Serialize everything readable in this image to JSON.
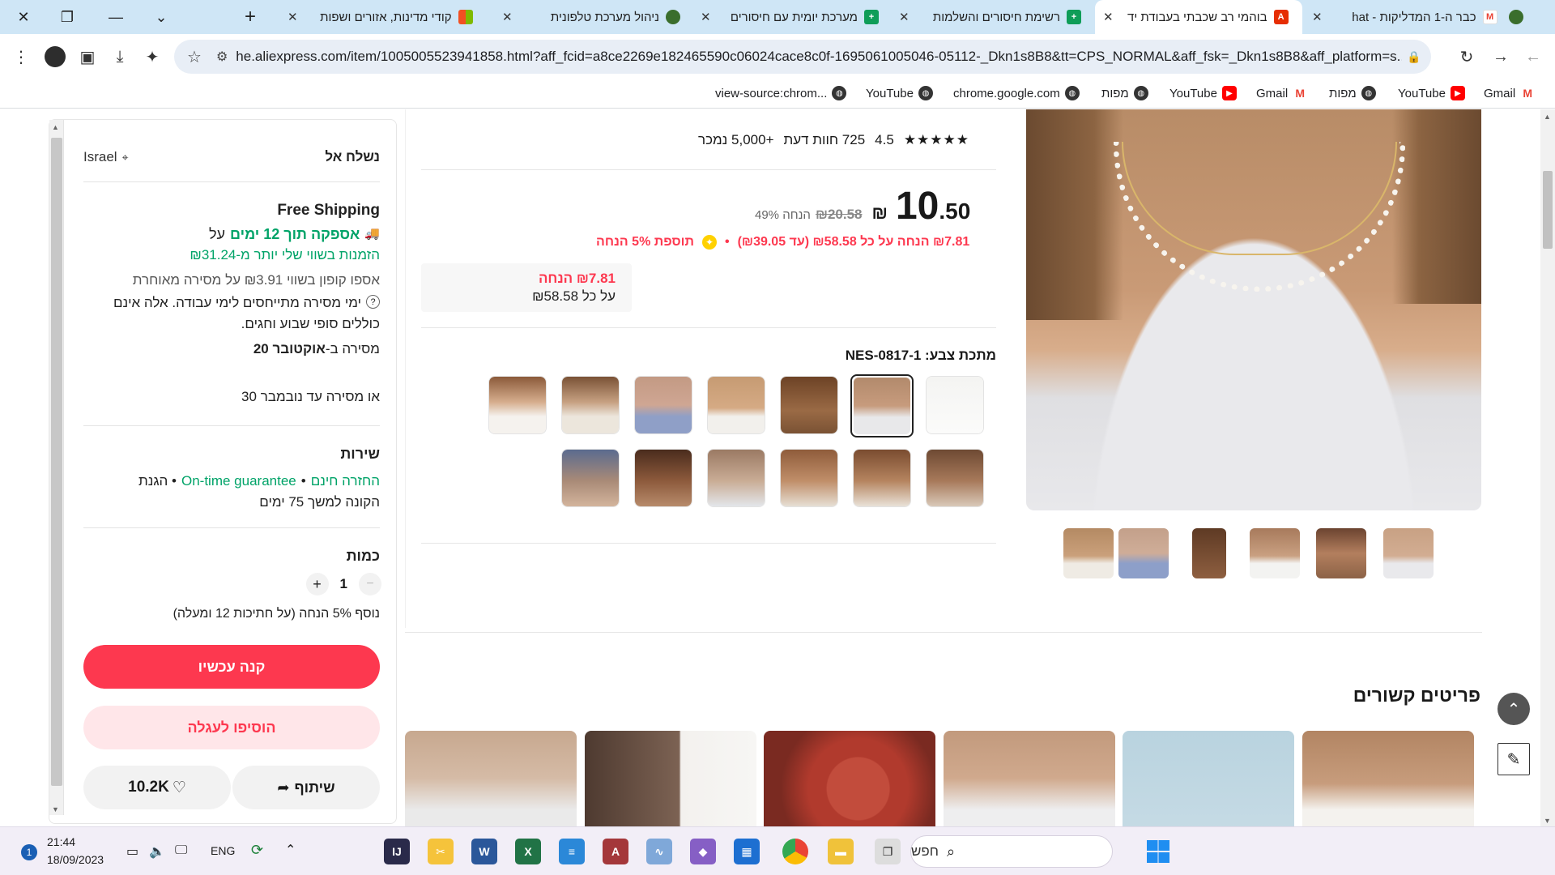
{
  "browser": {
    "tabs": [
      {
        "title": "כבר ה-1 המדליקות - hat",
        "icon": "gmail-icon",
        "active": false
      },
      {
        "title": "בוהמי רב שכבתי בעבודת יד",
        "icon": "aliexpress-icon",
        "active": true
      },
      {
        "title": "רשימת חיסורים והשלמות",
        "icon": "sheets-icon",
        "active": false
      },
      {
        "title": "מערכת יומית עם חיסורים",
        "icon": "sheets-icon",
        "active": false
      },
      {
        "title": "ניהול מערכת טלפונית",
        "icon": "site-icon",
        "active": false
      },
      {
        "title": "קודי מדינות, אזורים ושפות",
        "icon": "windows-icon",
        "active": false
      }
    ],
    "url": "he.aliexpress.com/item/1005005523941858.html?aff_fcid=a8ce2269e182465590c06024cace8c0f-1695061005046-05112-_Dkn1s8B8&tt=CPS_NORMAL&aff_fsk=_Dkn1s8B8&aff_platform=s...",
    "bookmarks": [
      {
        "label": "Gmail",
        "icon": "gmail-icon"
      },
      {
        "label": "YouTube",
        "icon": "youtube-icon"
      },
      {
        "label": "מפות",
        "icon": "globe-icon"
      },
      {
        "label": "Gmail",
        "icon": "gmail-icon"
      },
      {
        "label": "YouTube",
        "icon": "youtube-icon"
      },
      {
        "label": "מפות",
        "icon": "globe-icon"
      },
      {
        "label": "chrome.google.com",
        "icon": "globe-icon"
      },
      {
        "label": "YouTube",
        "icon": "globe-icon"
      },
      {
        "label": "view-source:chrom...",
        "icon": "globe-icon"
      }
    ]
  },
  "product": {
    "rating": "4.5",
    "reviews": "725 חוות דעת",
    "sold": "+5,000 נמכר",
    "price_int": "10",
    "price_dec": ".50",
    "currency": "₪",
    "old_price": "₪20.58",
    "discount": "49% הנחה",
    "promo_line": "₪7.81 הנחה על כל ₪58.58 (עד ₪39.05)",
    "promo_bullet": "•",
    "extra_promo": "תוספת 5% הנחה",
    "coupon_amount": "₪7.81 הנחה",
    "coupon_min": "על כל ₪58.58",
    "variant_label": "מתכת צבע: NES-0817-1",
    "related_title": "פריטים קשורים"
  },
  "buy": {
    "ship_to_label": "נשלח אל",
    "ship_to_country": "Israel",
    "free_shipping": "Free Shipping",
    "delivery_line": "אספקה תוך 12 ימים",
    "delivery_on": "על",
    "min_order": "הזמנות בשווי שלי יותר מ-₪31.24",
    "late_coupon": "אספו קופון בשווי ₪3.91 על מסירה מאוחרת",
    "note1": "ימי מסירה מתייחסים לימי עבודה. אלה אינם",
    "note2": "כוללים סופי שבוע וחגים.",
    "delivery_date_prefix": "מסירה ב-",
    "delivery_date": "אוקטובר 20",
    "or_delivery": "או מסירה עד נובמבר 30",
    "service_title": "שירות",
    "free_return": "החזרה חינם",
    "bullet": "•",
    "guarantee": "On-time guarantee",
    "protection1": "• הגנת",
    "protection2": "הקונה למשך 75 ימים",
    "qty_title": "כמות",
    "qty_value": "1",
    "qty_minus": "−",
    "qty_plus": "+",
    "qty_discount": "נוסף 5% הנחה (על חתיכות 12 ומעלה)",
    "buy_now": "קנה עכשיו",
    "add_to_cart": "הוסיפו לעגלה",
    "share": "שיתוף",
    "wishlist_count": "10.2K"
  },
  "taskbar": {
    "search_placeholder": "חפש",
    "lang": "ENG",
    "time": "21:44",
    "date": "18/09/2023",
    "notif": "1"
  },
  "colors": {
    "accent_red": "#fd384f",
    "light_red": "#ffe6e9",
    "green": "#00a368",
    "tab_bar": "#cfe6f6"
  }
}
